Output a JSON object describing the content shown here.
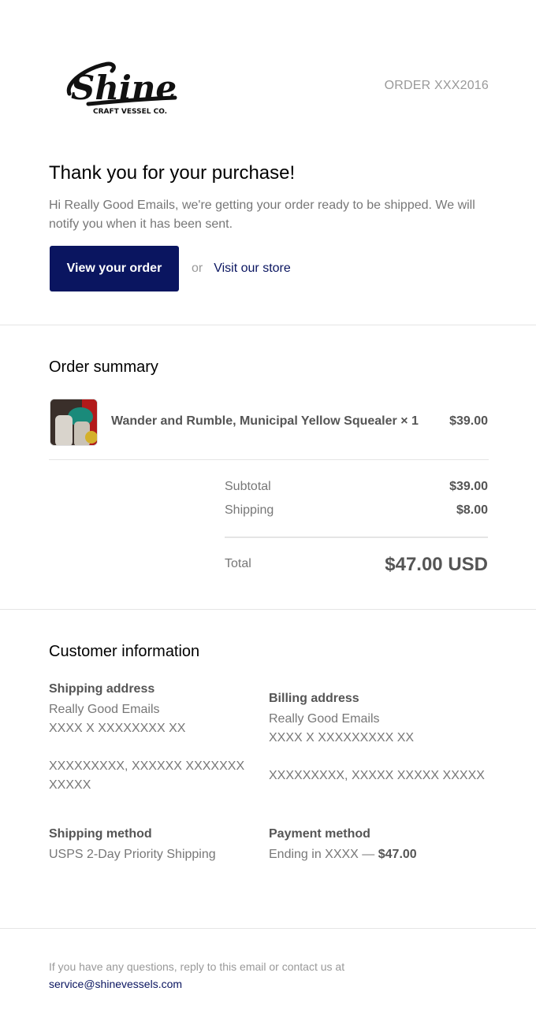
{
  "header": {
    "logo_text": "Shine",
    "logo_subtext": "CRAFT VESSEL CO.",
    "order_number": "ORDER XXX2016"
  },
  "intro": {
    "title": "Thank you for your purchase!",
    "message": "Hi Really Good Emails, we're getting your order ready to be shipped. We will notify you when it has been sent.",
    "view_order_label": "View your order",
    "or_label": "or",
    "store_link_label": "Visit our store"
  },
  "summary": {
    "title": "Order summary",
    "item_name": "Wander and Rumble, Municipal Yellow Squealer × 1",
    "item_price": "$39.00",
    "subtotal_label": "Subtotal",
    "subtotal_value": "$39.00",
    "shipping_label": "Shipping",
    "shipping_value": "$8.00",
    "total_label": "Total",
    "total_value": "$47.00 USD"
  },
  "customer": {
    "title": "Customer information",
    "shipping_address": {
      "heading": "Shipping address",
      "name": "Really Good Emails",
      "line1": "XXXX X XXXXXXXX XX",
      "line2": "XXXXXXXXX, XXXXXX XXXXXXX XXXXX"
    },
    "billing_address": {
      "heading": "Billing address",
      "name": "Really Good Emails",
      "line1": "XXXX X XXXXXXXXX XX",
      "line2": "XXXXXXXXX, XXXXX XXXXX XXXXX"
    },
    "shipping_method": {
      "heading": "Shipping method",
      "value": "USPS 2-Day Priority Shipping"
    },
    "payment_method": {
      "heading": "Payment method",
      "value": "Ending in XXXX —",
      "amount": "$47.00"
    }
  },
  "footer": {
    "text": "If you have any questions, reply to this email or contact us at",
    "email": "service@shinevessels.com"
  },
  "colors": {
    "brand": "#0a1560",
    "muted": "#777777",
    "divider": "#e5e5e5"
  }
}
